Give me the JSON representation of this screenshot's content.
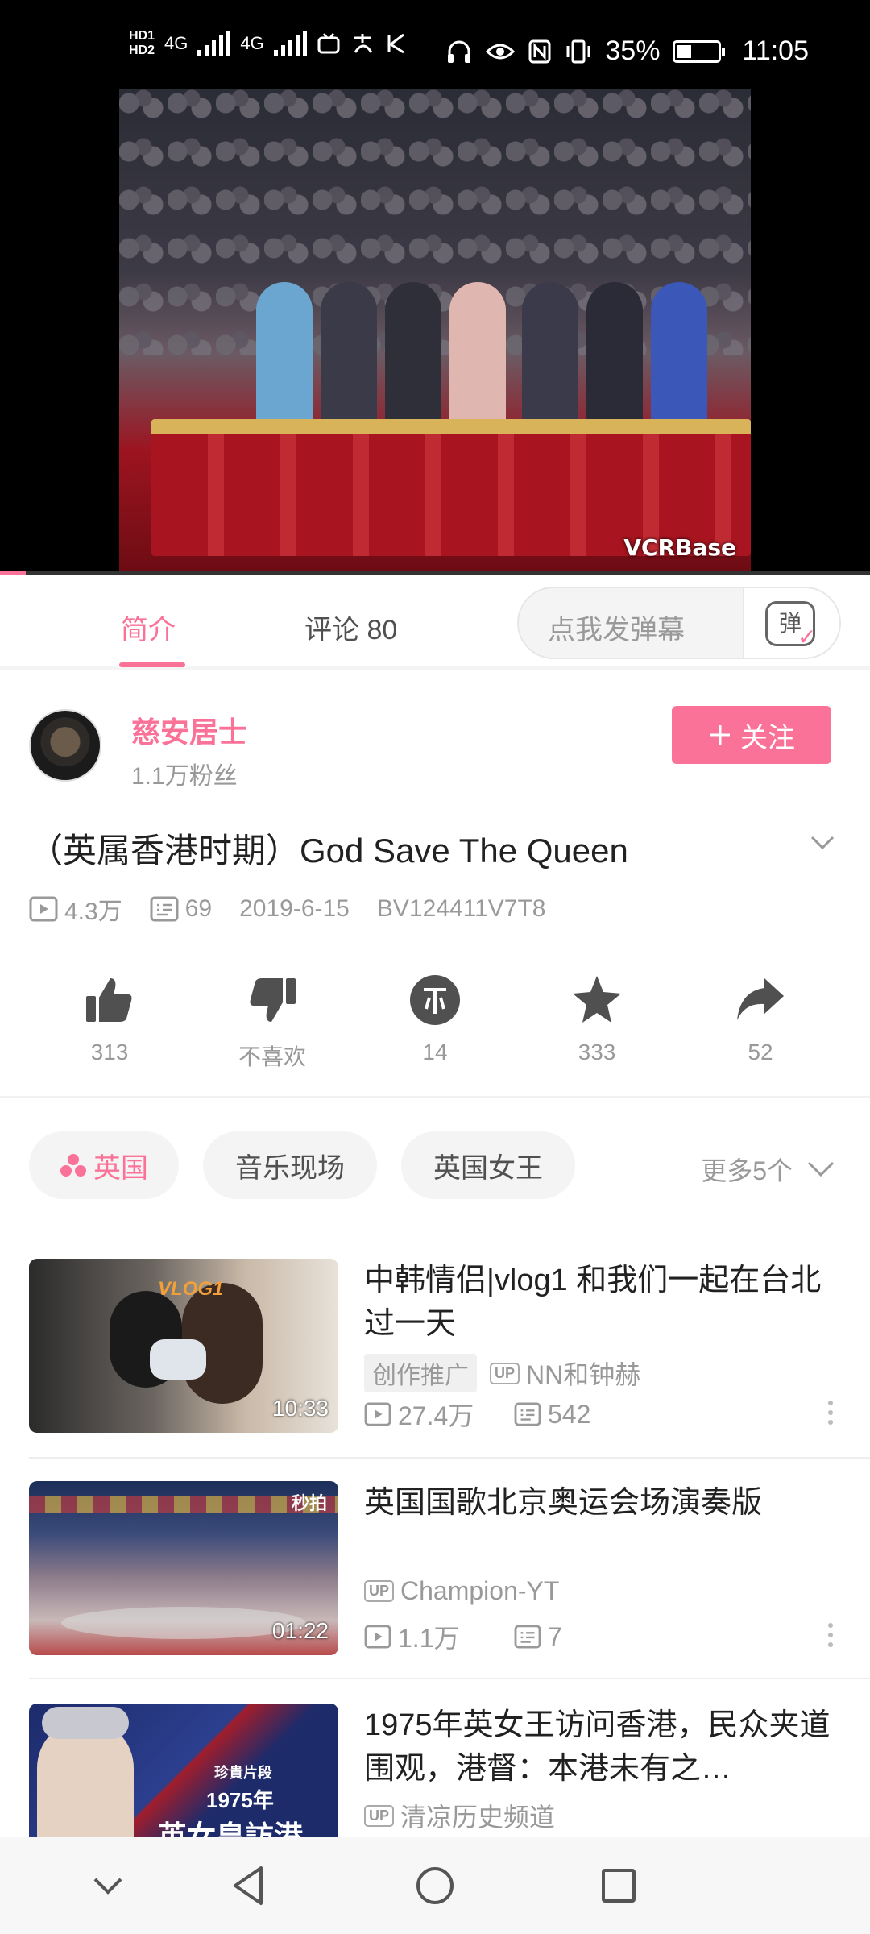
{
  "status_bar": {
    "hd_top": "HD1",
    "hd_bottom": "HD2",
    "net1": "4G",
    "net2": "4G",
    "battery_pct": "35%",
    "battery_level": 0.35,
    "time": "11:05"
  },
  "video": {
    "watermark": "VCRBase",
    "progress": 0.03
  },
  "tabs": {
    "intro": "简介",
    "comments": "评论 80",
    "danmaku_placeholder": "点我发弹幕",
    "danmaku_btn": "弹"
  },
  "uploader": {
    "name": "慈安居士",
    "fans": "1.1万粉丝",
    "follow_label": "关注"
  },
  "video_info": {
    "title": "（英属香港时期）God Save The Queen",
    "views": "4.3万",
    "danmaku": "69",
    "date": "2019-6-15",
    "bvid": "BV124411V7T8"
  },
  "actions": {
    "like": "313",
    "dislike": "不喜欢",
    "coin": "14",
    "favorite": "333",
    "share": "52"
  },
  "tags": {
    "items": [
      "英国",
      "音乐现场",
      "英国女王"
    ],
    "more": "更多5个"
  },
  "recommendations": [
    {
      "title": "中韩情侣|vlog1 和我们一起在台北过一天",
      "badge": "创作推广",
      "up": "NN和钟赫",
      "views": "27.4万",
      "danmaku": "542",
      "duration": "10:33",
      "thumb_text": "VLOG1"
    },
    {
      "title": "英国国歌北京奥运会场演奏版",
      "up": "Champion-YT",
      "views": "1.1万",
      "danmaku": "7",
      "duration": "01:22",
      "thumb_text": "秒拍"
    },
    {
      "title": "1975年英女王访问香港，民众夹道围观，港督：本港未有之…",
      "up": "清凉历史频道",
      "thumb_text_1": "珍貴片段",
      "thumb_text_2": "1975年",
      "thumb_text_3": "英女皇訪港"
    }
  ],
  "up_label": "UP",
  "colors": {
    "accent": "#fb7299",
    "grey_text": "#999999"
  }
}
